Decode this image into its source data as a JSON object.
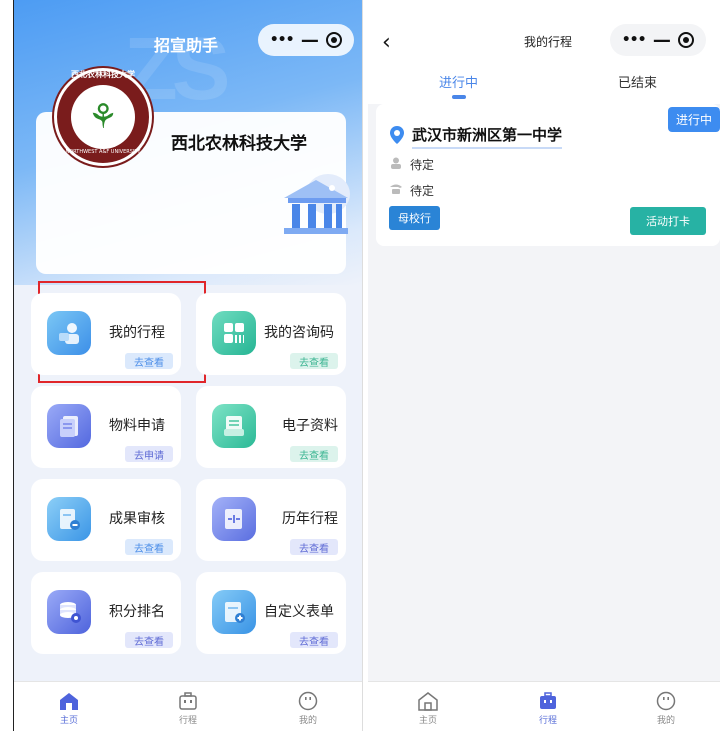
{
  "left": {
    "app_title": "招宣助手",
    "university_name": "西北农林科技大学",
    "logo_top_text": "西北农林科技大学",
    "logo_bottom_text": "NORTHWEST A&F UNIVERSITY",
    "logo_year": "1934",
    "menu": [
      {
        "label": "我的行程",
        "badge": "去查看",
        "icon": "trip-icon",
        "highlighted": true
      },
      {
        "label": "我的咨询码",
        "badge": "去查看",
        "icon": "qrcode-icon"
      },
      {
        "label": "物料申请",
        "badge": "去申请",
        "icon": "materials-icon"
      },
      {
        "label": "电子资料",
        "badge": "去查看",
        "icon": "documents-icon"
      },
      {
        "label": "成果审核",
        "badge": "去查看",
        "icon": "review-icon"
      },
      {
        "label": "历年行程",
        "badge": "去查看",
        "icon": "history-icon"
      },
      {
        "label": "积分排名",
        "badge": "去查看",
        "icon": "ranking-icon"
      },
      {
        "label": "自定义表单",
        "badge": "去查看",
        "icon": "form-icon"
      }
    ],
    "tabbar": [
      "主页",
      "行程",
      "我的"
    ],
    "active_tab": "主页"
  },
  "right": {
    "page_title": "我的行程",
    "tabs": [
      "进行中",
      "已结束"
    ],
    "active_tab": "行程",
    "trip": {
      "status": "进行中",
      "title": "武汉市新洲区第一中学",
      "person": "待定",
      "phone": "待定",
      "school_button": "母校行",
      "checkin_button": "活动打卡"
    },
    "tabbar": [
      "主页",
      "行程",
      "我的"
    ]
  },
  "colors": {
    "accent_blue": "#4a86e8",
    "highlight_red": "#e0262a",
    "teal_button": "#27b2a4"
  }
}
